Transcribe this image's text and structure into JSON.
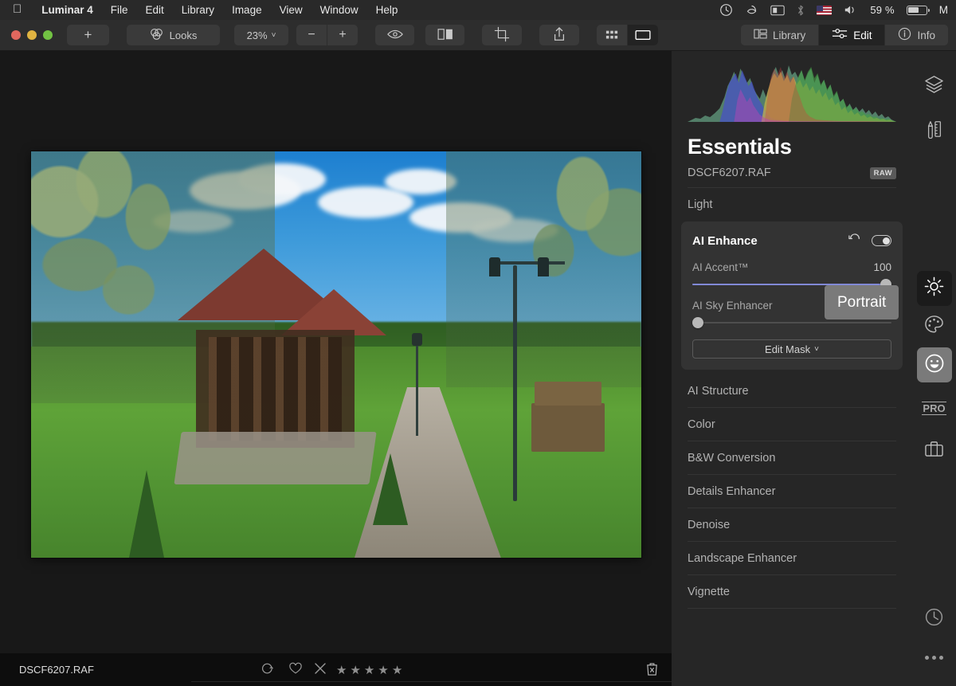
{
  "menubar": {
    "apple_icon": "apple-icon",
    "app_name": "Luminar 4",
    "items": [
      "File",
      "Edit",
      "Library",
      "Image",
      "View",
      "Window",
      "Help"
    ],
    "status": {
      "time_machine_icon": "time-machine-icon",
      "dropbox_icon": "dropbox-icon",
      "display_icon": "display-icon",
      "bluetooth_icon": "bluetooth-icon",
      "flag_icon": "us-flag-icon",
      "volume_icon": "volume-icon",
      "battery_percent": "59 %",
      "battery_icon": "battery-icon",
      "truncated_item": "M"
    }
  },
  "toolbar": {
    "add_label": "+",
    "looks_label": "Looks",
    "looks_icon": "looks-icon",
    "zoom_level": "23%",
    "zoom_caret": "˅",
    "zoom_out": "−",
    "zoom_in": "+",
    "preview_icon": "eye-icon",
    "compare_icon": "compare-split-icon",
    "crop_icon": "crop-icon",
    "share_icon": "share-icon",
    "grid_icon": "grid-view-icon",
    "single_icon": "single-view-icon",
    "modes": [
      {
        "label": "Library",
        "icon": "library-icon",
        "active": false
      },
      {
        "label": "Edit",
        "icon": "sliders-icon",
        "active": true
      },
      {
        "label": "Info",
        "icon": "info-icon",
        "active": false
      }
    ]
  },
  "panel": {
    "title": "Essentials",
    "file_name": "DSCF6207.RAF",
    "raw_badge": "RAW",
    "histogram_label": "histogram",
    "sections_before": [
      {
        "label": "Light"
      }
    ],
    "card": {
      "title": "AI Enhance",
      "reset_icon": "reset-icon",
      "toggle_icon": "toggle-on-icon",
      "sliders": [
        {
          "label": "AI Accent™",
          "value": "100",
          "fill_pct": 100
        },
        {
          "label": "AI Sky Enhancer",
          "value": "0",
          "fill_pct": 0
        }
      ],
      "mask_button": "Edit Mask",
      "mask_caret": "˅"
    },
    "sections_after": [
      {
        "label": "AI Structure"
      },
      {
        "label": "Color"
      },
      {
        "label": "B&W Conversion"
      },
      {
        "label": "Details Enhancer"
      },
      {
        "label": "Denoise"
      },
      {
        "label": "Landscape Enhancer"
      },
      {
        "label": "Vignette"
      }
    ]
  },
  "tooltip": {
    "text": "Portrait"
  },
  "rail": {
    "items": [
      {
        "name": "layers-icon",
        "state": "normal"
      },
      {
        "name": "tools-icon",
        "state": "normal"
      },
      {
        "name": "essentials-sun-icon",
        "state": "active"
      },
      {
        "name": "creative-palette-icon",
        "state": "normal"
      },
      {
        "name": "portrait-smiley-icon",
        "state": "hover"
      },
      {
        "name": "pro-icon",
        "state": "normal",
        "label": "PRO"
      },
      {
        "name": "briefcase-icon",
        "state": "normal"
      },
      {
        "name": "history-clock-icon",
        "state": "normal"
      },
      {
        "name": "more-dots-icon",
        "state": "normal"
      }
    ]
  },
  "statusbar": {
    "file_name": "DSCF6207.RAF",
    "color_label_icon": "color-label-icon",
    "favorite_icon": "heart-icon",
    "reject_icon": "reject-x-icon",
    "stars": [
      "★",
      "★",
      "★",
      "★",
      "★"
    ],
    "trash_icon": "trash-icon"
  },
  "colors": {
    "accent_slider": "#8189d6",
    "panel_bg": "#262626",
    "toolbar_bg": "#2d2d2d",
    "menubar_bg": "#292929",
    "tooltip_bg": "#7a7a7a"
  }
}
